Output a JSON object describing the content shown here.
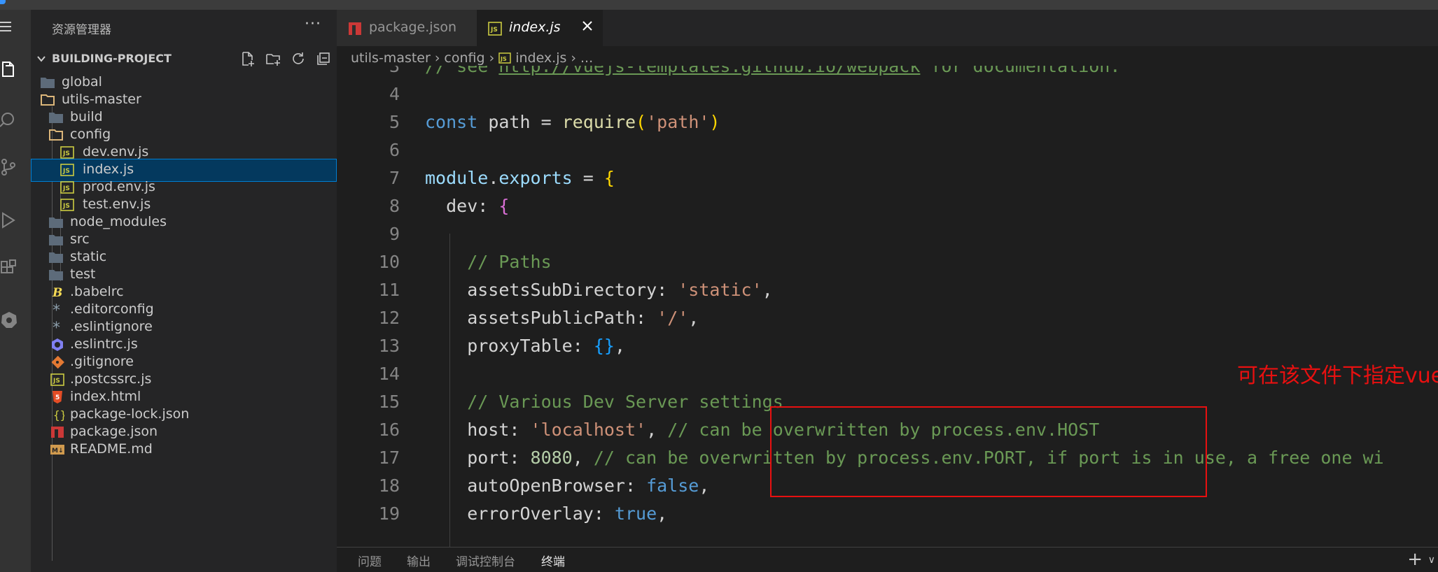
{
  "sidebar": {
    "title": "资源管理器",
    "more": "···",
    "section_title": "BUILDING-PROJECT",
    "items": [
      {
        "label": "global",
        "type": "folder"
      },
      {
        "label": "utils-master",
        "type": "folder-open"
      },
      {
        "label": "build",
        "type": "folder"
      },
      {
        "label": "config",
        "type": "folder-open"
      },
      {
        "label": "dev.env.js",
        "type": "js"
      },
      {
        "label": "index.js",
        "type": "js"
      },
      {
        "label": "prod.env.js",
        "type": "js"
      },
      {
        "label": "test.env.js",
        "type": "js"
      },
      {
        "label": "node_modules",
        "type": "folder"
      },
      {
        "label": "src",
        "type": "folder"
      },
      {
        "label": "static",
        "type": "folder"
      },
      {
        "label": "test",
        "type": "folder"
      },
      {
        "label": ".babelrc",
        "type": "babel"
      },
      {
        "label": ".editorconfig",
        "type": "gear"
      },
      {
        "label": ".eslintignore",
        "type": "gear"
      },
      {
        "label": ".eslintrc.js",
        "type": "eslint"
      },
      {
        "label": ".gitignore",
        "type": "git"
      },
      {
        "label": ".postcssrc.js",
        "type": "js"
      },
      {
        "label": "index.html",
        "type": "html"
      },
      {
        "label": "package-lock.json",
        "type": "json"
      },
      {
        "label": "package.json",
        "type": "npm"
      },
      {
        "label": "README.md",
        "type": "md"
      }
    ]
  },
  "tabs": [
    {
      "label": "package.json"
    },
    {
      "label": "index.js"
    }
  ],
  "breadcrumb": [
    "utils-master",
    "config",
    "index.js",
    "..."
  ],
  "code_lines": [
    {
      "num": "3",
      "text": "// see http://vuejs-templates.github.io/webpack for documentation."
    },
    {
      "num": "4",
      "text": ""
    },
    {
      "num": "5",
      "text": "const path = require('path')"
    },
    {
      "num": "6",
      "text": ""
    },
    {
      "num": "7",
      "text": "module.exports = {"
    },
    {
      "num": "8",
      "text": "  dev: {"
    },
    {
      "num": "9",
      "text": ""
    },
    {
      "num": "10",
      "text": "    // Paths"
    },
    {
      "num": "11",
      "text": "    assetsSubDirectory: 'static',"
    },
    {
      "num": "12",
      "text": "    assetsPublicPath: '/',"
    },
    {
      "num": "13",
      "text": "    proxyTable: {},"
    },
    {
      "num": "14",
      "text": ""
    },
    {
      "num": "15",
      "text": "    // Various Dev Server settings"
    },
    {
      "num": "16",
      "text": "    host: 'localhost', // can be overwritten by process.env.HOST"
    },
    {
      "num": "17",
      "text": "    port: 8080, // can be overwritten by process.env.PORT, if port is in use, a free one wi"
    },
    {
      "num": "18",
      "text": "    autoOpenBrowser: false,"
    },
    {
      "num": "19",
      "text": "    errorOverlay: true,"
    }
  ],
  "annotation": "可在该文件下指定vue项目启动的ip和端口",
  "panel": {
    "tabs": [
      "问题",
      "输出",
      "调试控制台",
      "终端"
    ],
    "active": "终端",
    "plus": "+",
    "chevron": "∨"
  },
  "colors": {
    "accent": "#007fd4",
    "annotation": "#e81010",
    "folder": "#c09553"
  }
}
